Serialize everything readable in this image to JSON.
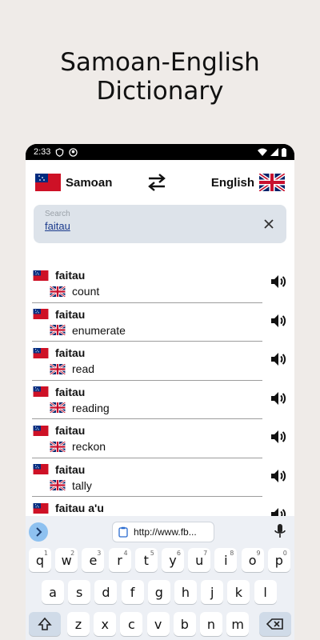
{
  "promo": {
    "title": "Samoan-English\nDictionary"
  },
  "status_bar": {
    "time": "2:33"
  },
  "lang_bar": {
    "source": "Samoan",
    "target": "English"
  },
  "search": {
    "placeholder": "Search",
    "value": "faitau"
  },
  "results": [
    {
      "word": "faitau",
      "translation": "count"
    },
    {
      "word": "faitau",
      "translation": "enumerate"
    },
    {
      "word": "faitau",
      "translation": "read"
    },
    {
      "word": "faitau",
      "translation": "reading"
    },
    {
      "word": "faitau",
      "translation": "reckon"
    },
    {
      "word": "faitau",
      "translation": "tally"
    },
    {
      "word": "faitau a'u",
      "translation": ""
    }
  ],
  "keyboard": {
    "url_chip": "http://www.fb...",
    "row1": [
      [
        "q",
        "1"
      ],
      [
        "w",
        "2"
      ],
      [
        "e",
        "3"
      ],
      [
        "r",
        "4"
      ],
      [
        "t",
        "5"
      ],
      [
        "y",
        "6"
      ],
      [
        "u",
        "7"
      ],
      [
        "i",
        "8"
      ],
      [
        "o",
        "9"
      ],
      [
        "p",
        "0"
      ]
    ],
    "row2": [
      "a",
      "s",
      "d",
      "f",
      "g",
      "h",
      "j",
      "k",
      "l"
    ],
    "row3": [
      "z",
      "x",
      "c",
      "v",
      "b",
      "n",
      "m"
    ]
  },
  "colors": {
    "samoa_red": "#ce1126",
    "samoa_blue": "#002b7f",
    "uk_blue": "#012169",
    "uk_red": "#c8102e"
  }
}
